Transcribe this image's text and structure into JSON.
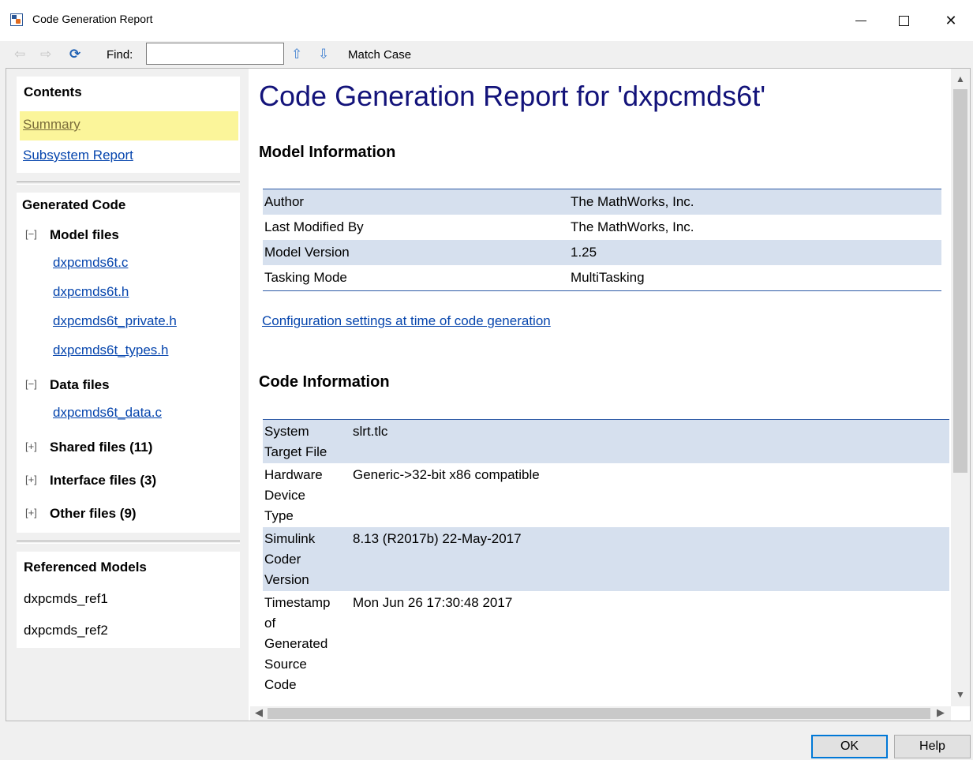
{
  "window": {
    "title": "Code Generation Report",
    "controls": {
      "minimize": "—",
      "maximize": "☐",
      "close": "✕"
    }
  },
  "toolbar": {
    "back_icon": "⇦",
    "forward_icon": "⇨",
    "refresh_icon": "⟳",
    "find_label": "Find:",
    "find_value": "",
    "find_up_icon": "⇧",
    "find_down_icon": "⇩",
    "match_case_label": "Match Case"
  },
  "nav": {
    "contents_heading": "Contents",
    "summary_link": "Summary",
    "subsystem_link": "Subsystem Report",
    "generated_code_heading": "Generated Code",
    "model_files": {
      "toggle": "[−]",
      "label": "Model files",
      "files": [
        "dxpcmds6t.c",
        "dxpcmds6t.h",
        "dxpcmds6t_private.h",
        "dxpcmds6t_types.h"
      ]
    },
    "data_files": {
      "toggle": "[−]",
      "label": "Data files",
      "files": [
        "dxpcmds6t_data.c"
      ]
    },
    "shared_files": {
      "toggle": "[+]",
      "label": "Shared files (11)"
    },
    "interface_files": {
      "toggle": "[+]",
      "label": "Interface files (3)"
    },
    "other_files": {
      "toggle": "[+]",
      "label": "Other files (9)"
    },
    "referenced_heading": "Referenced Models",
    "referenced_models": [
      "dxpcmds_ref1",
      "dxpcmds_ref2"
    ]
  },
  "report": {
    "title": "Code Generation Report for 'dxpcmds6t'",
    "model_info_heading": "Model Information",
    "model_info": [
      {
        "key": "Author",
        "value": "The MathWorks, Inc."
      },
      {
        "key": "Last Modified By",
        "value": "The MathWorks, Inc."
      },
      {
        "key": "Model Version",
        "value": "1.25"
      },
      {
        "key": "Tasking Mode",
        "value": "MultiTasking"
      }
    ],
    "config_link": "Configuration settings at time of code generation",
    "code_info_heading": "Code Information",
    "code_info": [
      {
        "key_lines": [
          "System",
          "Target File"
        ],
        "value": "slrt.tlc"
      },
      {
        "key_lines": [
          "Hardware",
          "Device",
          "Type"
        ],
        "value": "Generic->32-bit x86 compatible"
      },
      {
        "key_lines": [
          "Simulink",
          "Coder",
          "Version"
        ],
        "value": "8.13 (R2017b) 22-May-2017"
      },
      {
        "key_lines": [
          "Timestamp",
          "of",
          "Generated",
          "Source",
          "Code"
        ],
        "value": "Mon Jun 26 17:30:48 2017"
      }
    ]
  },
  "scrollbars": {
    "up": "▲",
    "down": "▼",
    "left": "◀",
    "right": "▶"
  },
  "buttons": {
    "ok": "OK",
    "help": "Help"
  }
}
